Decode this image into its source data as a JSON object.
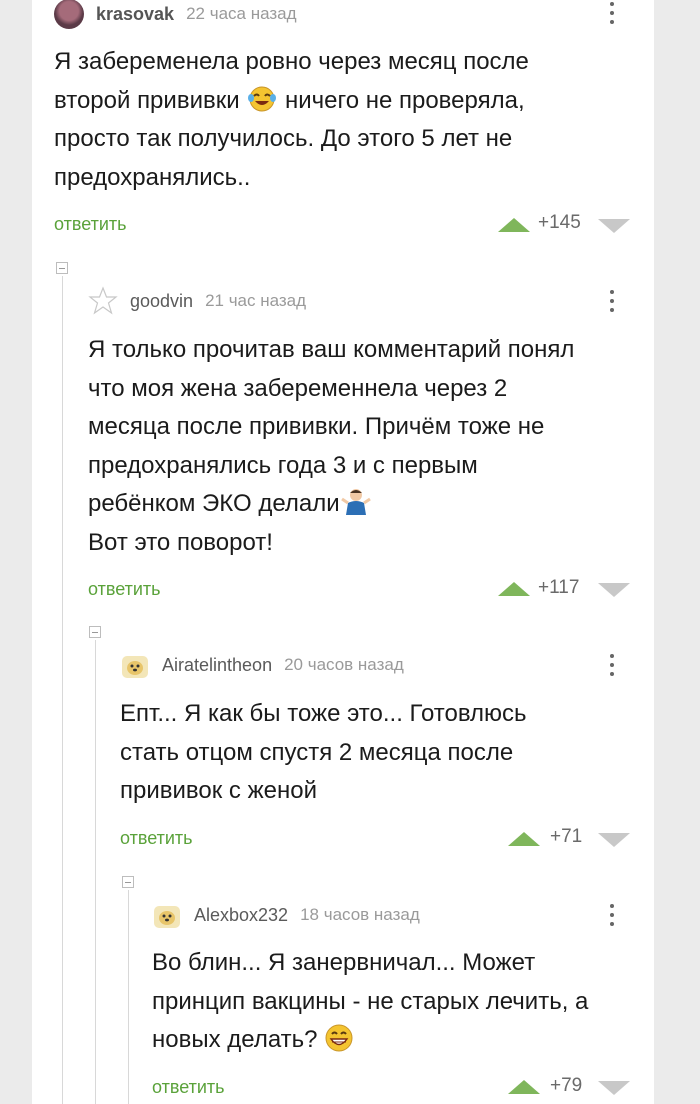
{
  "colors": {
    "reply": "#5aa23a",
    "upvote": "#7fb65b",
    "downvote": "#c8c8c8"
  },
  "comments": [
    {
      "username": "krasovak",
      "time": "22 часа назад",
      "lines": [
        "Я забеременела ровно через месяц после",
        "второй прививки",
        "ничего не проверяла,",
        "просто так получилось. До этого 5 лет не",
        "предохранялись.."
      ],
      "reply": "ответить",
      "score": "+145"
    },
    {
      "username": "goodvin",
      "time": "21 час назад",
      "lines": [
        "Я только прочитав ваш комментарий понял",
        "что моя жена забеременнела через 2",
        "месяца после прививки. Причём тоже не",
        "предохранялись года 3 и с первым",
        "ребёнком ЭКО делали",
        "Вот это поворот!"
      ],
      "reply": "ответить",
      "score": "+117"
    },
    {
      "username": "Airatelintheon",
      "time": "20 часов назад",
      "lines": [
        "Епт... Я как бы тоже это... Готовлюсь",
        "стать отцом спустя 2 месяца после",
        "прививок с женой"
      ],
      "reply": "ответить",
      "score": "+71"
    },
    {
      "username": "Alexbox232",
      "time": "18 часов назад",
      "lines": [
        "Во блин... Я занервничал... Может",
        "принцип вакцины - не старых лечить, а",
        "новых делать?"
      ],
      "reply": "ответить",
      "score": "+79"
    }
  ]
}
